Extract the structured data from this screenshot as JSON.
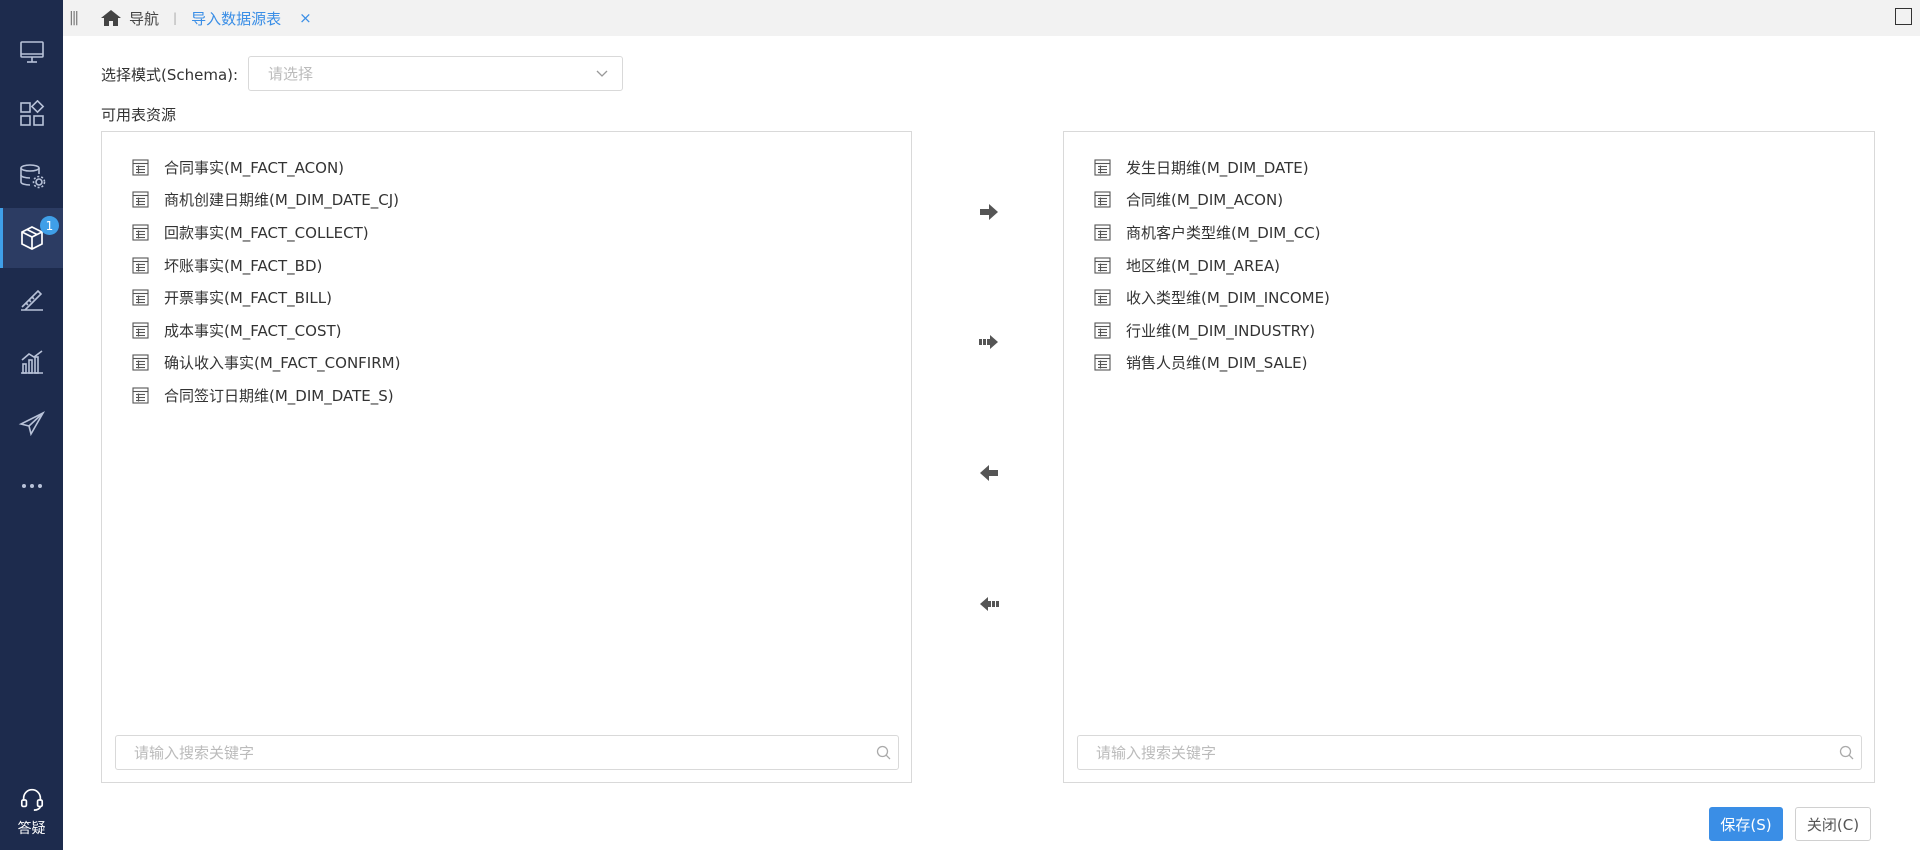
{
  "sidebar": {
    "items": [
      {
        "icon": "monitor-icon"
      },
      {
        "icon": "apps-grid-icon"
      },
      {
        "icon": "database-settings-icon"
      },
      {
        "icon": "cube-icon",
        "badge": "1",
        "active": true
      },
      {
        "icon": "ruler-triangle-icon"
      },
      {
        "icon": "bar-chart-icon"
      },
      {
        "icon": "paper-plane-icon"
      },
      {
        "icon": "more-dots-icon"
      }
    ],
    "help_label": "答疑"
  },
  "topbar": {
    "home_label": "导航",
    "active_tab": "导入数据源表",
    "close_glyph": "×"
  },
  "form": {
    "schema_label": "选择模式(Schema):",
    "schema_placeholder": "请选择",
    "available_label": "可用表资源"
  },
  "left_panel": {
    "items": [
      "合同事实(M_FACT_ACON)",
      "商机创建日期维(M_DIM_DATE_CJ)",
      "回款事实(M_FACT_COLLECT)",
      "坏账事实(M_FACT_BD)",
      "开票事实(M_FACT_BILL)",
      "成本事实(M_FACT_COST)",
      "确认收入事实(M_FACT_CONFIRM)",
      "合同签订日期维(M_DIM_DATE_S)"
    ],
    "search_placeholder": "请输入搜索关键字"
  },
  "right_panel": {
    "items": [
      "发生日期维(M_DIM_DATE)",
      "合同维(M_DIM_ACON)",
      "商机客户类型维(M_DIM_CC)",
      "地区维(M_DIM_AREA)",
      "收入类型维(M_DIM_INCOME)",
      "行业维(M_DIM_INDUSTRY)",
      "销售人员维(M_DIM_SALE)"
    ],
    "search_placeholder": "请输入搜索关键字"
  },
  "buttons": {
    "save": "保存(S)",
    "close": "关闭(C)"
  },
  "colors": {
    "sidebar_bg": "#1d2b4d",
    "accent": "#3a8ee6"
  }
}
